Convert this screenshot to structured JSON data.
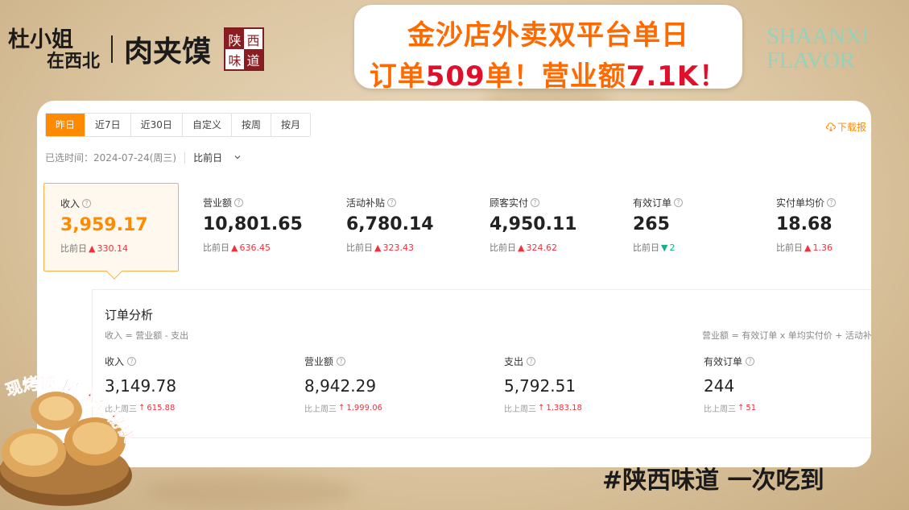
{
  "brand": {
    "name_line1": "杜小姐",
    "name_line2": "在西北",
    "product": "肉夹馍",
    "seal_chars": [
      "陕",
      "西",
      "味",
      "道"
    ]
  },
  "headline": {
    "line1": "金沙店外卖双平台单日",
    "line2_pre": "订单",
    "line2_num": "509",
    "line2_mid": "单！营业额",
    "line2_amount": "7.1K！"
  },
  "watermark": {
    "line1": "SHAANXI",
    "line2": "FLAVOR"
  },
  "toolbar": {
    "tabs": [
      {
        "label": "昨日",
        "active": true
      },
      {
        "label": "近7日",
        "active": false
      },
      {
        "label": "近30日",
        "active": false
      },
      {
        "label": "自定义",
        "active": false
      },
      {
        "label": "按周",
        "active": false
      },
      {
        "label": "按月",
        "active": false
      }
    ],
    "download_label": "下载报",
    "selected_time": "已选时间：2024-07-24(周三)",
    "compare_select": "比前日"
  },
  "kpis": [
    {
      "label": "收入",
      "value": "3,959.17",
      "delta_label": "比前日",
      "delta": "330.14",
      "trend": "up",
      "active": true
    },
    {
      "label": "营业额",
      "value": "10,801.65",
      "delta_label": "比前日",
      "delta": "636.45",
      "trend": "up",
      "active": false
    },
    {
      "label": "活动补贴",
      "value": "6,780.14",
      "delta_label": "比前日",
      "delta": "323.43",
      "trend": "up",
      "active": false
    },
    {
      "label": "顾客实付",
      "value": "4,950.11",
      "delta_label": "比前日",
      "delta": "324.62",
      "trend": "up",
      "active": false
    },
    {
      "label": "有效订单",
      "value": "265",
      "delta_label": "比前日",
      "delta": "2",
      "trend": "down",
      "active": false
    },
    {
      "label": "实付单均价",
      "value": "18.68",
      "delta_label": "比前日",
      "delta": "1.36",
      "trend": "up",
      "active": false
    }
  ],
  "analysis": {
    "title": "订单分析",
    "formula_left": "收入 = 营业额 - 支出",
    "formula_right": "营业额 = 有效订单 x 单均实付价 + 活动补",
    "metrics": [
      {
        "label": "收入",
        "value": "3,149.78",
        "delta_label": "比上周三",
        "delta": "615.88"
      },
      {
        "label": "营业额",
        "value": "8,942.29",
        "delta_label": "比上周三",
        "delta": "1,999.06"
      },
      {
        "label": "支出",
        "value": "5,792.51",
        "delta_label": "比上周三",
        "delta": "1,383.18"
      },
      {
        "label": "有效订单",
        "value": "244",
        "delta_label": "比上周三",
        "delta": "51"
      }
    ]
  },
  "decor": {
    "curved_text": "现烤馍 层酥脆 秘诀",
    "slogan": "#陕西味道 一次吃到"
  },
  "colors": {
    "accent": "#ff8a00",
    "headline": "#ff6a00",
    "up": "#f5303c",
    "down": "#14b08a",
    "seal": "#8a1c22"
  }
}
